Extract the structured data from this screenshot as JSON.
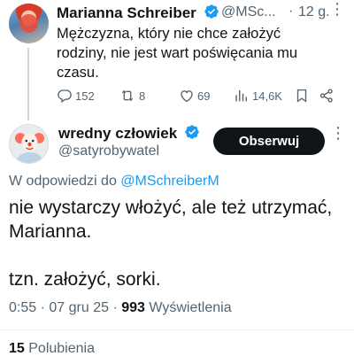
{
  "parent_tweet": {
    "author_name": "Marianna Schreiber",
    "handle": "@MSc...",
    "separator": "·",
    "time": "12 g.",
    "text": "Mężczyzna, który nie chce założyć\nrodziny, nie jest wart poświęcania mu\nczasu.",
    "replies": "152",
    "retweets": "8",
    "likes": "69",
    "views": "14,6K"
  },
  "reply_tweet": {
    "author_name": "wredny człowiek",
    "handle": "@satyrobywatel",
    "follow_label": "Obserwuj",
    "replying_to_prefix": "W odpowiedzi do",
    "replying_to_handle": "@MSchreiberM",
    "text": "nie wystarczy włożyć, ale też utrzymać,\nMarianna.\n\ntzn. założyć, sorki.",
    "time": "0:55",
    "date": "07 gru 25",
    "views_count": "993",
    "views_label": "Wyświetlenia",
    "likes_count": "15",
    "likes_label": "Polubienia"
  },
  "colors": {
    "accent": "#1d9bf0",
    "text_primary": "#0f1419",
    "text_secondary": "#536471",
    "verified": "#1d9bf0"
  },
  "icons": [
    "verified-badge-icon",
    "more-icon",
    "reply-icon",
    "retweet-icon",
    "like-icon",
    "views-icon",
    "bookmark-icon",
    "share-icon"
  ]
}
